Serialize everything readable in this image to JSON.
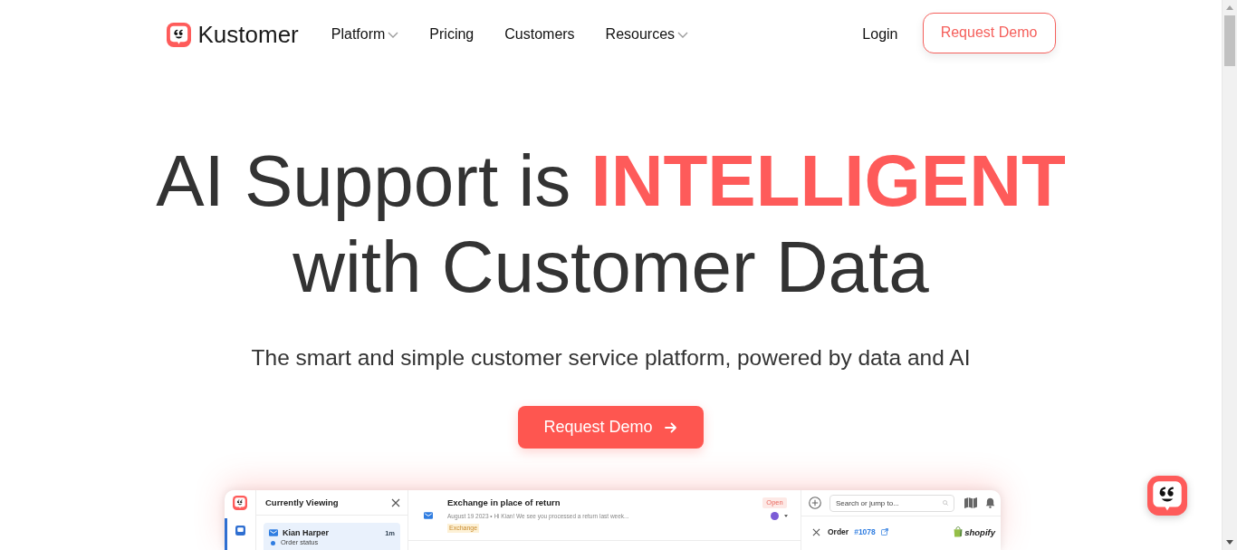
{
  "nav": {
    "brand": "Kustomer",
    "links": [
      {
        "label": "Platform",
        "dropdown": true
      },
      {
        "label": "Pricing",
        "dropdown": false
      },
      {
        "label": "Customers",
        "dropdown": false
      },
      {
        "label": "Resources",
        "dropdown": true
      }
    ],
    "login": "Login",
    "cta": "Request Demo"
  },
  "hero": {
    "title": "AI Support is **INTELLIGENT** with Customer Data",
    "subtitle": "The smart and simple customer service platform, powered by data and AI",
    "cta": "Request Demo"
  },
  "app_preview": {
    "rail_items": [
      {
        "selected": true
      }
    ],
    "list_panel": {
      "title": "Currently Viewing",
      "items": [
        {
          "name": "Kian Harper",
          "time": "1m",
          "preview": "Order status",
          "selected": true
        }
      ]
    },
    "conversation": {
      "subject": "Exchange in place of return",
      "meta": "August 19 2023 • Hi Kian! We see you processed a return last week...",
      "tag": "Exchange",
      "status": "Open"
    },
    "side_panel": {
      "search": {
        "placeholder": "Search or jump to..."
      },
      "record": {
        "type": "Order",
        "number": "#1078",
        "source": "shopify"
      }
    }
  }
}
